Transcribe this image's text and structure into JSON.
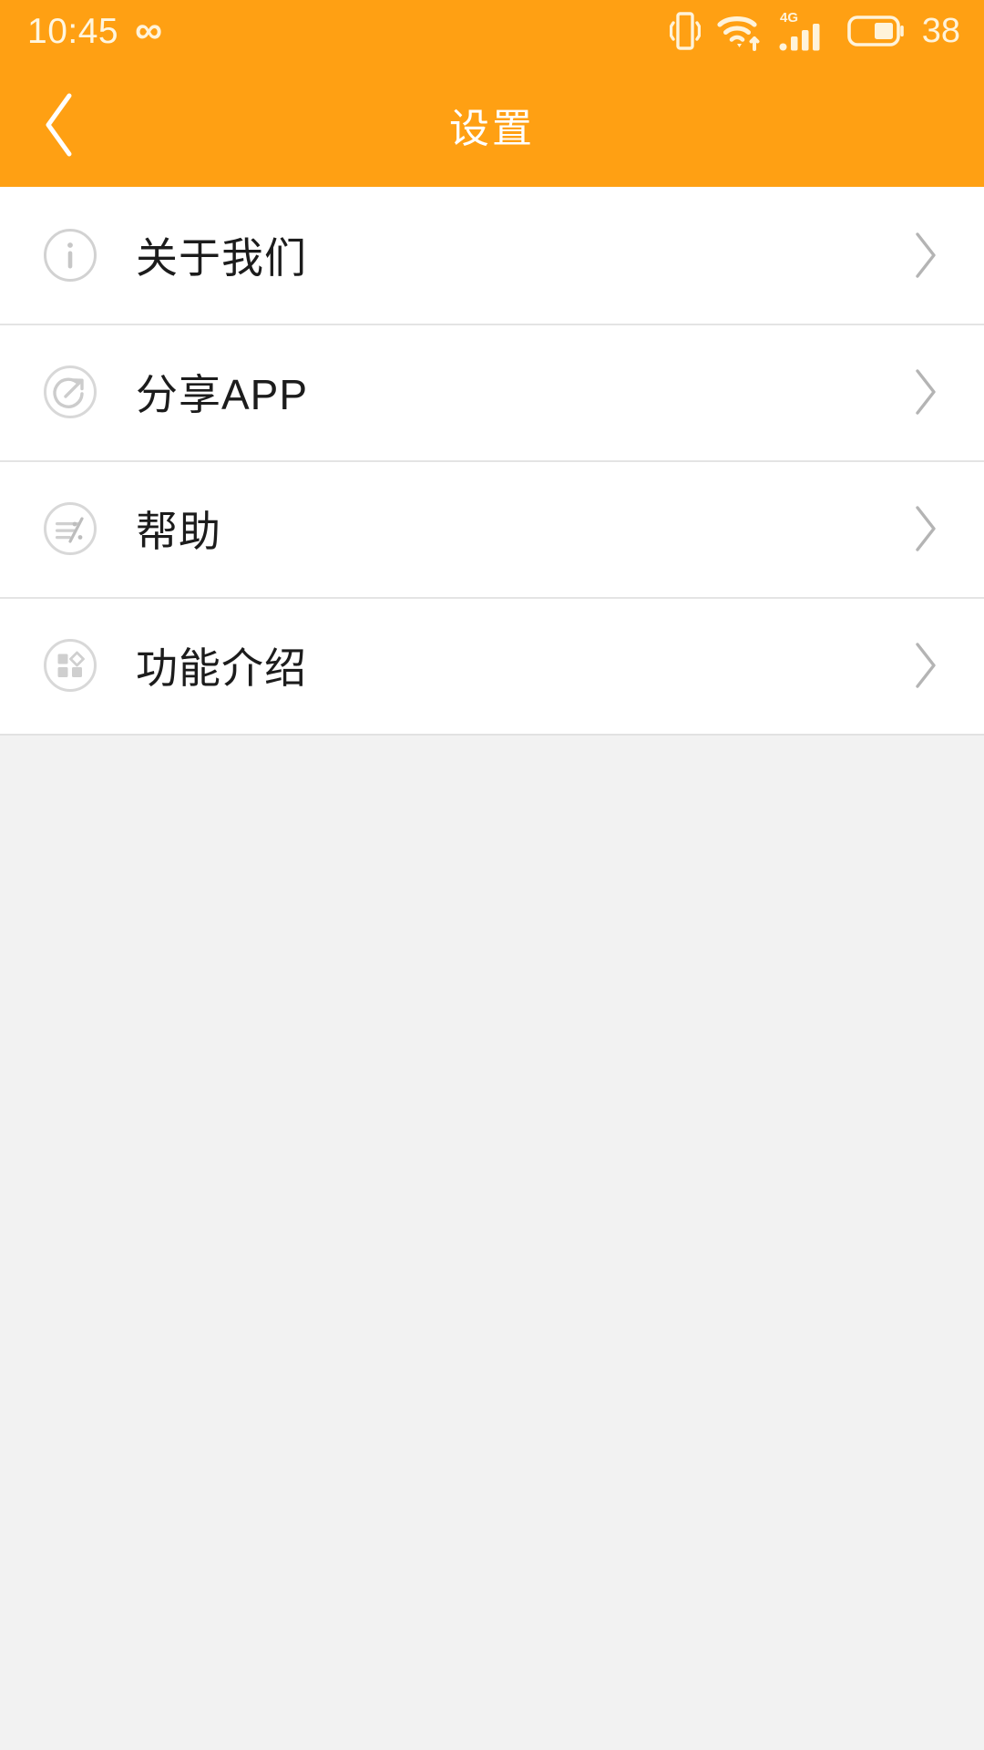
{
  "statusbar": {
    "time": "10:45",
    "infinity_glyph": "∞",
    "icons": [
      "vibrate-icon",
      "wifi-icon",
      "signal-4g-icon",
      "battery-icon"
    ],
    "network_label": "4G",
    "battery_percent": "38"
  },
  "header": {
    "title": "设置",
    "back_icon": "chevron-left-icon",
    "background_color": "#FFA013",
    "title_color": "#FFFFFF"
  },
  "list": {
    "items": [
      {
        "label": "关于我们",
        "icon": "info-circle-icon",
        "chevron": "chevron-right-icon"
      },
      {
        "label": "分享APP",
        "icon": "share-circle-icon",
        "chevron": "chevron-right-icon"
      },
      {
        "label": "帮助",
        "icon": "help-lines-circle-icon",
        "chevron": "chevron-right-icon"
      },
      {
        "label": "功能介绍",
        "icon": "grid-circle-icon",
        "chevron": "chevron-right-icon"
      }
    ]
  },
  "colors": {
    "accent": "#FFA013",
    "page_background": "#F2F2F2",
    "list_background": "#FFFFFF",
    "divider": "#E4E4E4",
    "label_text": "#1C1C1C",
    "icon_gray": "#CFCFCF",
    "chevron_gray": "#B4B4B4"
  }
}
